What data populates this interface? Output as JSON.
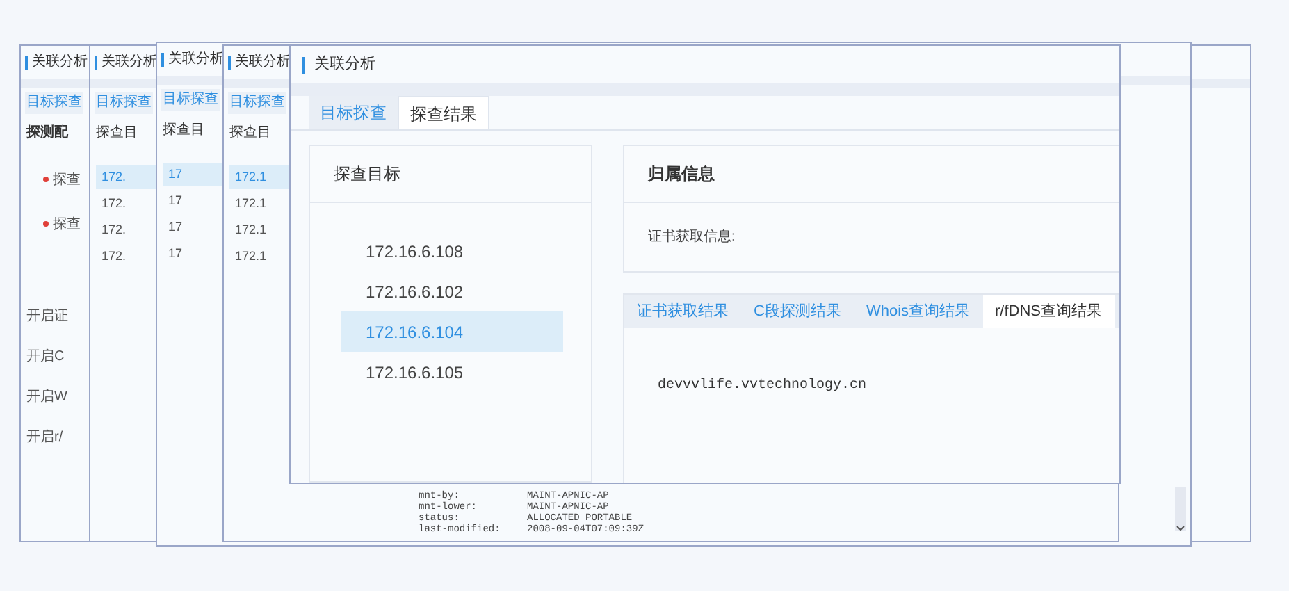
{
  "back_windows": [
    {
      "kind": "config",
      "title": "关联分析",
      "tab": "目标探查",
      "section": "探测配",
      "fields": [
        {
          "label": "探查",
          "required": true
        },
        {
          "label": "探查",
          "required": true
        }
      ],
      "switches": [
        "开启证",
        "开启C",
        "开启W",
        "开启r/"
      ]
    },
    {
      "kind": "results",
      "title": "关联分析",
      "tab": "目标探查",
      "section": "探查目",
      "targets": [
        {
          "ip": "172.",
          "selected": true
        },
        {
          "ip": "172.",
          "selected": false
        },
        {
          "ip": "172.",
          "selected": false
        },
        {
          "ip": "172.",
          "selected": false
        }
      ]
    },
    {
      "kind": "results",
      "title": "关联分析",
      "tab": "目标探查",
      "section": "探查目",
      "targets": [
        {
          "ip": "17",
          "selected": true
        },
        {
          "ip": "17",
          "selected": false
        },
        {
          "ip": "17",
          "selected": false
        },
        {
          "ip": "17",
          "selected": false
        }
      ]
    },
    {
      "kind": "results",
      "title": "关联分析",
      "tab": "目标探查",
      "section": "探查目",
      "targets": [
        {
          "ip": "172.1",
          "selected": true
        },
        {
          "ip": "172.1",
          "selected": false
        },
        {
          "ip": "172.1",
          "selected": false
        },
        {
          "ip": "172.1",
          "selected": false
        }
      ],
      "whois": [
        {
          "key": "mnt-by:",
          "value": "MAINT-APNIC-AP"
        },
        {
          "key": "mnt-lower:",
          "value": "MAINT-APNIC-AP"
        },
        {
          "key": "status:",
          "value": "ALLOCATED PORTABLE"
        },
        {
          "key": "last-modified:",
          "value": "2008-09-04T07:09:39Z"
        }
      ]
    }
  ],
  "front": {
    "title": "关联分析",
    "tabs": [
      {
        "label": "目标探查",
        "selected": false
      },
      {
        "label": "探查结果",
        "selected": true
      }
    ],
    "targets_title": "探查目标",
    "targets": [
      {
        "ip": "172.16.6.108",
        "selected": false
      },
      {
        "ip": "172.16.6.102",
        "selected": false
      },
      {
        "ip": "172.16.6.104",
        "selected": true
      },
      {
        "ip": "172.16.6.105",
        "selected": false
      }
    ],
    "info_title": "归属信息",
    "cert_label": "证书获取信息:",
    "result_tabs": [
      {
        "label": "证书获取结果",
        "selected": false
      },
      {
        "label": "C段探测结果",
        "selected": false
      },
      {
        "label": "Whois查询结果",
        "selected": false
      },
      {
        "label": "r/fDNS查询结果",
        "selected": true
      }
    ],
    "result_text": "devvvlife.vvtechnology.cn"
  }
}
